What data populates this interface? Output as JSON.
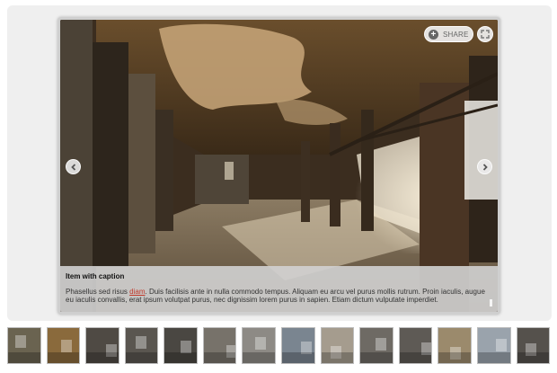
{
  "toolbar": {
    "share_label": "SHARE",
    "share_icon": "plus-icon",
    "fullscreen_icon": "fullscreen-icon"
  },
  "navigation": {
    "prev_icon": "chevron-left-icon",
    "next_icon": "chevron-right-icon"
  },
  "caption": {
    "title": "Item with caption",
    "body_before": "Phasellus sed risus ",
    "body_link": "diam",
    "body_after": ". Duis facilisis ante in nulla commodo tempus. Aliquam eu arcu vel purus mollis rutrum. Proin iaculis, augue eu iaculis convallis, erat ipsum volutpat purus, nec dignissim lorem purus in sapien. Etiam dictum vulputate imperdiet."
  },
  "thumbnails": [
    {
      "subject": "ornate-ceiling",
      "tone": "#6a6350"
    },
    {
      "subject": "lit-corridor",
      "tone": "#8a6a3c"
    },
    {
      "subject": "dark-room",
      "tone": "#4f4a44"
    },
    {
      "subject": "arched-hall",
      "tone": "#5a5650"
    },
    {
      "subject": "stairway",
      "tone": "#4a4742"
    },
    {
      "subject": "empty-ward",
      "tone": "#77726a"
    },
    {
      "subject": "grey-hallway",
      "tone": "#8d8a85"
    },
    {
      "subject": "building-exterior",
      "tone": "#7a8590"
    },
    {
      "subject": "lake-landscape",
      "tone": "#a59c8e"
    },
    {
      "subject": "abandoned-room",
      "tone": "#6e6a64"
    },
    {
      "subject": "rubble-floor",
      "tone": "#5e5a55"
    },
    {
      "subject": "gothic-hall",
      "tone": "#9b8a6c"
    },
    {
      "subject": "city-skyline",
      "tone": "#9aa3ac"
    },
    {
      "subject": "dim-chamber",
      "tone": "#55514c"
    }
  ]
}
